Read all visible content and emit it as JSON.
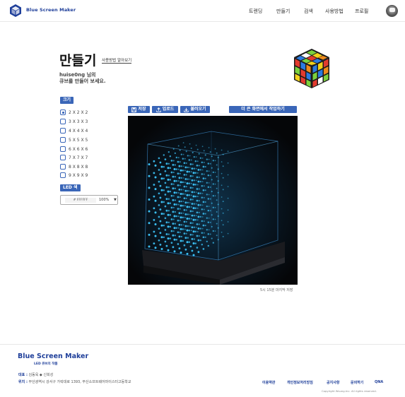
{
  "header": {
    "brand": "Blue Screen Maker",
    "nav": [
      "트렌딩",
      "만들기",
      "검색",
      "사용방법",
      "프로필"
    ]
  },
  "main": {
    "title": "만들기",
    "help_link": "사용방법 알아보기",
    "greeting_line1": "huise0ng 님의",
    "greeting_line2": "큐브를 만들어 보세요."
  },
  "size_panel": {
    "label": "크기",
    "options": [
      "2 X 2 X 2",
      "3 X 3 X 3",
      "4 X 4 X 4",
      "5 X 5 X 5",
      "6 X 6 X 6",
      "7 X 7 X 7",
      "8 X 8 X 8",
      "9 X 9 X 9"
    ],
    "selected": "2 X 2 X 2"
  },
  "led_color": {
    "label": "LED 색",
    "value": "# FFFFFF",
    "opacity": "100%"
  },
  "toolbar": {
    "save": "저장",
    "upload": "업로드",
    "load": "불러오기",
    "large_view": "더 큰 화면에서 작업하기"
  },
  "canvas": {
    "status": "5시 15분 마지막 저장"
  },
  "footer": {
    "brand": "Blue Screen Maker",
    "subtitle": "LED 큐브의 작품",
    "rep_label": "대표 :",
    "rep_value": "김동욱 ◆ 신희성",
    "loc_label": "위치 :",
    "loc_value": "부산광역시 강서구 가락대로 1393, 부산소프트웨어마이스터고등학교",
    "links": [
      "이용약관",
      "개인정보처리방침",
      "공지사항",
      "문의하기",
      "QNA"
    ],
    "copyright": "Copyright Wsung.Inc. All rights reserved."
  },
  "colors": {
    "brand_blue": "#1f3f9a",
    "button_blue": "#3a66b8",
    "led_cyan": "#3ec9ff"
  },
  "icons": [
    "logo-cube-icon",
    "rubiks-cube-icon",
    "save-icon",
    "upload-icon",
    "download-icon",
    "profile-avatar"
  ]
}
